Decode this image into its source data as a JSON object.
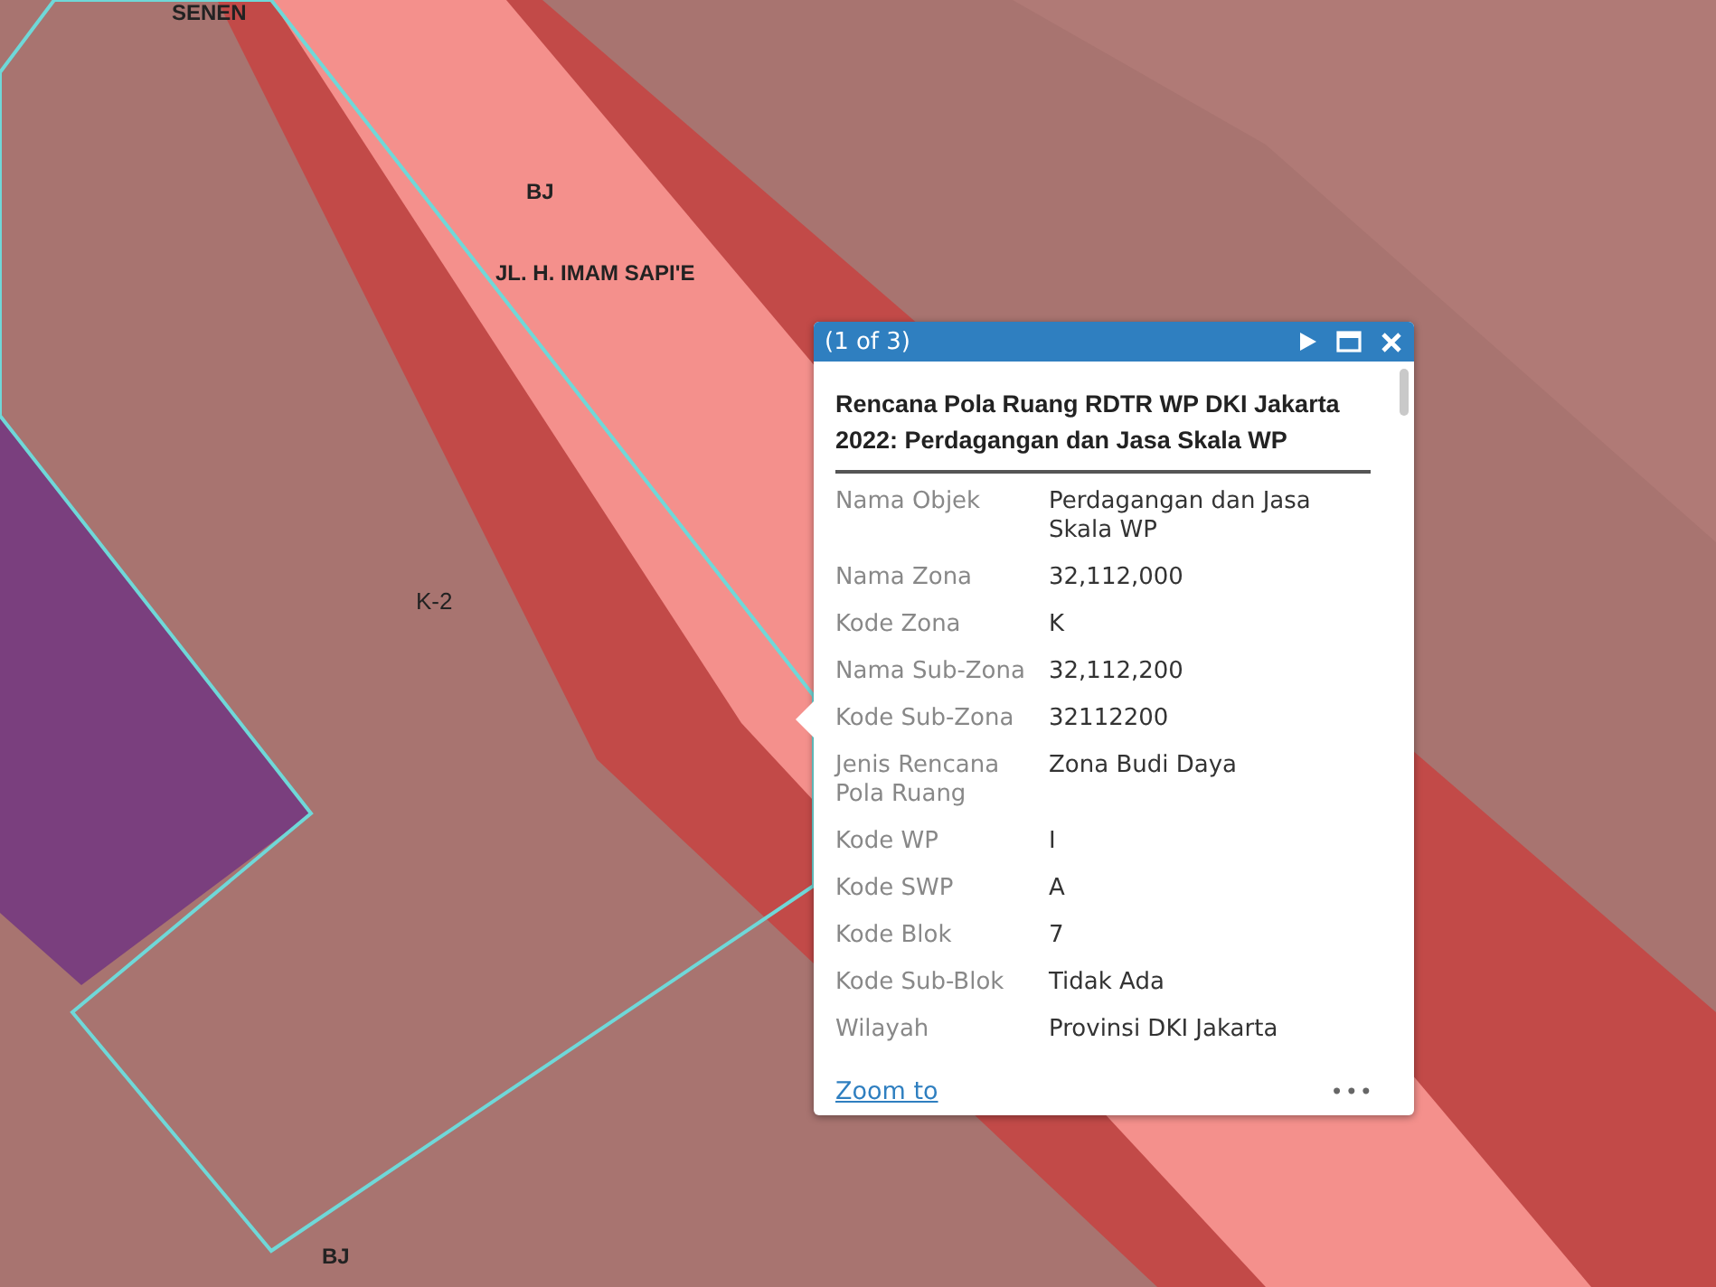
{
  "map": {
    "labels": [
      {
        "text": "SENEN",
        "kind": "top"
      },
      {
        "text": "BJ",
        "kind": "road"
      },
      {
        "text": "JL. H. IMAM SAPI'E",
        "kind": "street"
      },
      {
        "text": "K-2",
        "kind": "zone"
      },
      {
        "text": "BJ",
        "kind": "bottom"
      }
    ]
  },
  "popup": {
    "counter": "(1 of 3)",
    "title": "Rencana Pola Ruang RDTR WP DKI Jakarta 2022: Perdagangan dan Jasa Skala WP",
    "fields": [
      {
        "label": "Nama Objek",
        "value": "Perdagangan dan Jasa Skala WP"
      },
      {
        "label": "Nama Zona",
        "value": "32,112,000"
      },
      {
        "label": "Kode Zona",
        "value": "K"
      },
      {
        "label": "Nama Sub-Zona",
        "value": "32,112,200"
      },
      {
        "label": "Kode Sub-Zona",
        "value": "32112200"
      },
      {
        "label": "Jenis Rencana Pola Ruang",
        "value": "Zona Budi Daya"
      },
      {
        "label": "Kode WP",
        "value": "I"
      },
      {
        "label": "Kode SWP",
        "value": "A"
      },
      {
        "label": "Kode Blok",
        "value": "7"
      },
      {
        "label": "Kode Sub-Blok",
        "value": "Tidak Ada"
      },
      {
        "label": "Wilayah",
        "value": "Provinsi DKI Jakarta"
      }
    ],
    "link": "Zoom to",
    "more": "•••"
  }
}
